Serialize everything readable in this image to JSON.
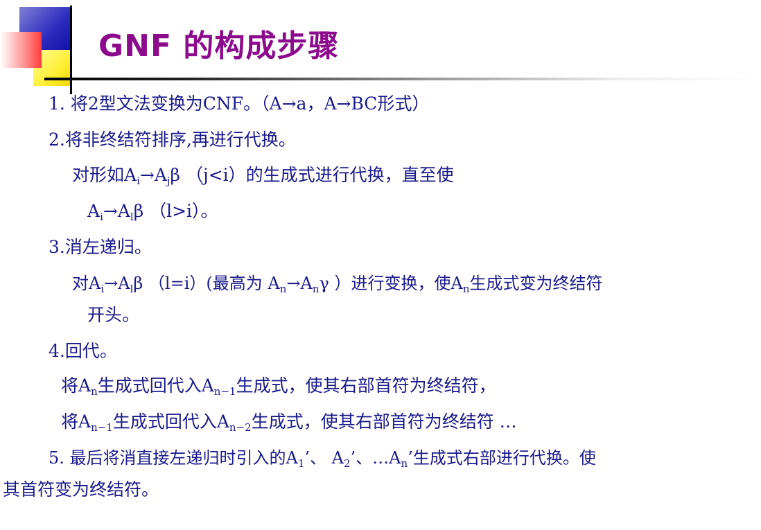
{
  "title": "GNF 的构成步骤",
  "step1": {
    "num": "1.",
    "text": "将2型文法变换为CNF。（A→a，A→BC形式）"
  },
  "step2": {
    "text": "2.将非终结符排序,再进行代换。",
    "line_a": {
      "pre": "对形如A",
      "sub1": "i",
      "mid": "→A",
      "sub2": "j",
      "post": "β （j<i）的生成式进行代换，直至使"
    },
    "line_b": {
      "pre": "A",
      "sub1": "i",
      "mid": "→A",
      "sub2": "l",
      "post": "β （l>i）。"
    }
  },
  "step3": {
    "text": "3.消左递归。",
    "line_a": {
      "p1": "对A",
      "s1": "i",
      "p2": "→A",
      "s2": "l",
      "p3": "β （l=i）(最高为 A",
      "s3": "n",
      "p4": "→A",
      "s4": "n",
      "p5": "γ ）进行变换，使A",
      "s5": "n",
      "p6": "生成式变为终结符"
    },
    "line_b": "开头。"
  },
  "step4": {
    "text": "4.回代。",
    "line_a": {
      "p1": "将A",
      "s1": "n",
      "p2": "生成式回代入A",
      "s2": "n−1",
      "p3": "生成式，使其右部首符为终结符，"
    },
    "line_b": {
      "p1": "将A",
      "s1": "n−1",
      "p2": "生成式回代入A",
      "s2": "n−2",
      "p3": "生成式，使其右部首符为终结符 …"
    }
  },
  "step5": {
    "line_a": {
      "p1": "5.  最后将消直接左递归时引入的A",
      "s1": "1",
      "p2": "’、 A",
      "s2": "2",
      "p3": "’、…A",
      "s3": "n",
      "p4": "’生成式右部进行代换。使"
    },
    "line_b": "其首符变为终结符。"
  }
}
